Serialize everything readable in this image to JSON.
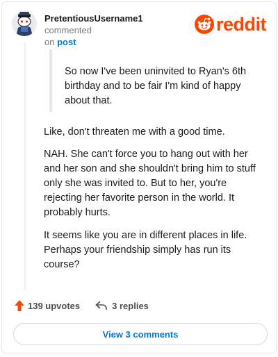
{
  "header": {
    "username": "PretentiousUsername1",
    "action_text": "commented",
    "preposition": "on",
    "post_link": "post",
    "logo_text": "reddit"
  },
  "comment": {
    "quote": "So now I've been uninvited to Ryan's 6th birthday and to be fair I'm kind of happy about that.",
    "paragraphs": [
      "Like, don't threaten me with a good time.",
      "NAH. She can't force you to hang out with her and her son and she shouldn't bring him to stuff only she was invited to. But to her, you're rejecting her favorite person in the world. It probably hurts.",
      "It seems like you are in different places in life. Perhaps your friendship simply has run its course?"
    ]
  },
  "actions": {
    "upvotes": "139 upvotes",
    "replies": "3 replies",
    "view_comments": "View 3 comments"
  },
  "icons": {
    "avatar": "snoo-avatar",
    "logo": "reddit-snoo-logo-icon",
    "upvote": "upvote-arrow-icon",
    "reply": "reply-arrow-icon"
  },
  "colors": {
    "brand": "#ff4500",
    "link": "#0079d3",
    "muted_text": "#7c7c7c",
    "quote_bar": "#e6e6e6"
  }
}
